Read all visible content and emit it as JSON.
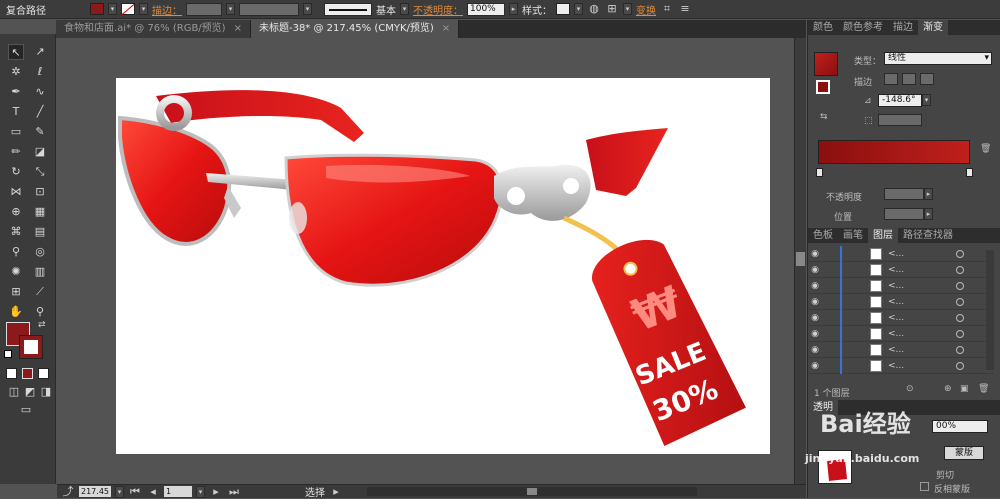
{
  "control_bar": {
    "selection_type": "复合路径",
    "stroke_label": "描边：",
    "stroke_profile": "基本",
    "opacity_label": "不透明度：",
    "opacity_value": "100%",
    "style_label": "样式：",
    "transform_label": "变换",
    "fill_color": "#8b1a1a"
  },
  "document_tabs": [
    {
      "label": "食物和店面.ai* @ 76% (RGB/预览)"
    },
    {
      "label": "未标题-38* @ 217.45% (CMYK/预览)"
    }
  ],
  "artwork": {
    "tag_text_sale": "SALE",
    "tag_text_percent": "30%",
    "tag_symbol": "₩"
  },
  "status_bar": {
    "zoom": "217.45",
    "page": "1",
    "tool_status": "选择"
  },
  "color_panel": {
    "tabs": [
      "颜色",
      "颜色参考",
      "描边",
      "渐变"
    ],
    "active_tab": "渐变",
    "type_label": "类型：",
    "type_value": "线性",
    "stroke_label": "描边",
    "angle_value": "-148.6°",
    "opacity_label": "不透明度",
    "position_label": "位置",
    "gradient_start": "#8a0f0f",
    "gradient_end": "#c0201c"
  },
  "layers_panel": {
    "tabs": [
      "色板",
      "画笔",
      "图层",
      "路径查找器"
    ],
    "active_tab": "图层",
    "rows": [
      {
        "name": "<..."
      },
      {
        "name": "<..."
      },
      {
        "name": "<..."
      },
      {
        "name": "<..."
      },
      {
        "name": "<..."
      },
      {
        "name": "<..."
      },
      {
        "name": "<..."
      },
      {
        "name": "<..."
      }
    ],
    "layer_count": "1 个图层"
  },
  "lower_panel": {
    "tab": "透明",
    "opacity_value": "00%",
    "mask_button": "蒙版",
    "clip_label": "剪切",
    "invert_label": "反相蒙版"
  },
  "watermark": {
    "text": "Bai经验",
    "url": "jingyan.baidu.com"
  }
}
